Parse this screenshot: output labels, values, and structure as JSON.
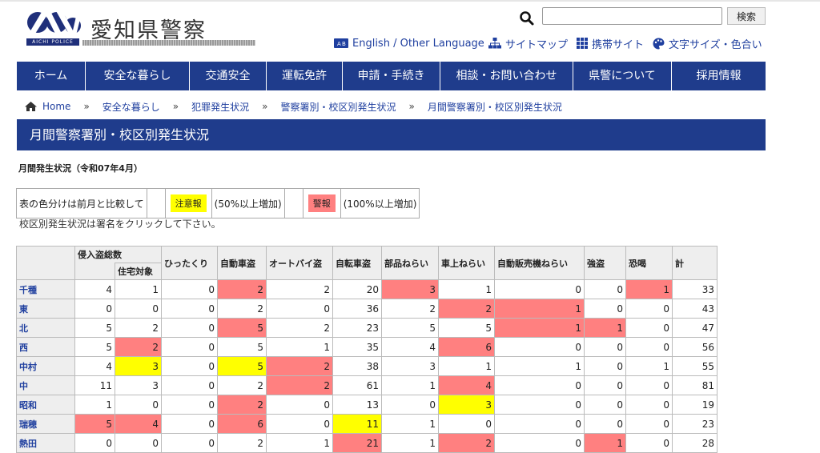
{
  "header": {
    "logo_title": "愛知県警察",
    "logo_sub": "AICHI POLICE",
    "search": {
      "placeholder": "",
      "button": "検索"
    },
    "utility": [
      {
        "icon": "language-icon",
        "label": "English / Other Language"
      },
      {
        "icon": "sitemap-icon",
        "label": "サイトマップ"
      },
      {
        "icon": "mobile-icon",
        "label": "携帯サイト"
      },
      {
        "icon": "palette-icon",
        "label": "文字サイズ・色合い"
      }
    ]
  },
  "nav": [
    "ホーム",
    "安全な暮らし",
    "交通安全",
    "運転免許",
    "申請・手続き",
    "相談・お問い合わせ",
    "県警について",
    "採用情報"
  ],
  "breadcrumb": [
    "Home",
    "安全な暮らし",
    "犯罪発生状況",
    "警察署別・校区別発生状況",
    "月間警察署別・校区別発生状況"
  ],
  "page_title": "月間警察署別・校区別発生状況",
  "subhead": "月間発生状況（令和07年4月）",
  "legend": {
    "intro": "表の色分けは前月と比較して",
    "caution_label": "注意報",
    "caution_desc": "(50%以上増加)",
    "warning_label": "警報",
    "warning_desc": "(100%以上増加)",
    "colors": {
      "caution": "#ffff00",
      "warning": "#ff8080"
    }
  },
  "note": "校区別発生状況は署名をクリックして下さい。",
  "table": {
    "group_header": "侵入盗総数",
    "sub_header": "住宅対象",
    "headers": [
      "ひったくり",
      "自動車盗",
      "オートバイ盗",
      "自転車盗",
      "部品ねらい",
      "車上ねらい",
      "自動販売機ねらい",
      "強盗",
      "恐喝",
      "計"
    ],
    "rows": [
      {
        "name": "千種",
        "values": [
          4,
          1,
          0,
          2,
          2,
          20,
          3,
          1,
          0,
          0,
          1,
          33
        ],
        "colors": [
          "",
          "",
          "",
          "r",
          "",
          "",
          "r",
          "",
          "",
          "",
          "r",
          ""
        ]
      },
      {
        "name": "東",
        "values": [
          0,
          0,
          0,
          2,
          0,
          36,
          2,
          2,
          1,
          0,
          0,
          43
        ],
        "colors": [
          "",
          "",
          "",
          "",
          "",
          "",
          "",
          "r",
          "r",
          "",
          "",
          ""
        ]
      },
      {
        "name": "北",
        "values": [
          5,
          2,
          0,
          5,
          2,
          23,
          5,
          5,
          1,
          1,
          0,
          47
        ],
        "colors": [
          "",
          "",
          "",
          "r",
          "",
          "",
          "",
          "",
          "r",
          "r",
          "",
          ""
        ]
      },
      {
        "name": "西",
        "values": [
          5,
          2,
          0,
          5,
          1,
          35,
          4,
          6,
          0,
          0,
          0,
          56
        ],
        "colors": [
          "",
          "r",
          "",
          "",
          "",
          "",
          "",
          "r",
          "",
          "",
          "",
          ""
        ]
      },
      {
        "name": "中村",
        "values": [
          4,
          3,
          0,
          5,
          2,
          38,
          3,
          1,
          1,
          0,
          1,
          55
        ],
        "colors": [
          "",
          "y",
          "",
          "y",
          "r",
          "",
          "",
          "",
          "",
          "",
          "",
          ""
        ]
      },
      {
        "name": "中",
        "values": [
          11,
          3,
          0,
          2,
          2,
          61,
          1,
          4,
          0,
          0,
          0,
          81
        ],
        "colors": [
          "",
          "",
          "",
          "",
          "r",
          "",
          "",
          "r",
          "",
          "",
          "",
          ""
        ]
      },
      {
        "name": "昭和",
        "values": [
          1,
          0,
          0,
          2,
          0,
          13,
          0,
          3,
          0,
          0,
          0,
          19
        ],
        "colors": [
          "",
          "",
          "",
          "r",
          "",
          "",
          "",
          "y",
          "",
          "",
          "",
          ""
        ]
      },
      {
        "name": "瑞穂",
        "values": [
          5,
          4,
          0,
          6,
          0,
          11,
          1,
          0,
          0,
          0,
          0,
          23
        ],
        "colors": [
          "r",
          "r",
          "",
          "r",
          "",
          "y",
          "",
          "",
          "",
          "",
          "",
          ""
        ]
      },
      {
        "name": "熱田",
        "values": [
          0,
          0,
          0,
          2,
          1,
          21,
          1,
          2,
          0,
          1,
          0,
          28
        ],
        "colors": [
          "",
          "",
          "",
          "",
          "",
          "r",
          "",
          "r",
          "",
          "r",
          "",
          ""
        ]
      }
    ]
  }
}
